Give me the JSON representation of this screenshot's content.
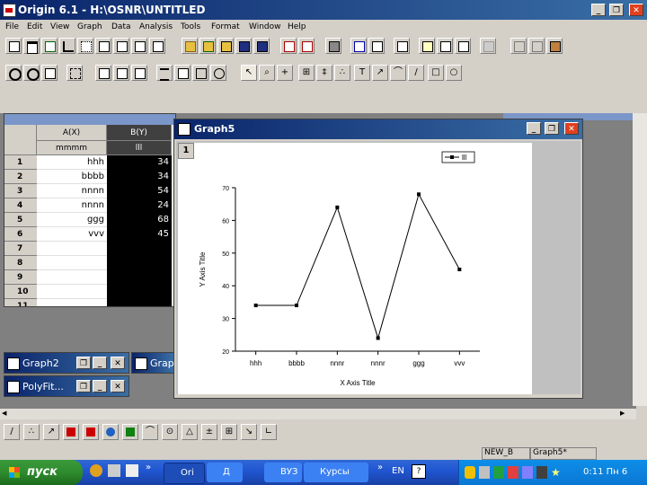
{
  "app": {
    "title": "Origin 6.1 - H:\\OSNR\\UNTITLED"
  },
  "window_controls": {
    "minimize": "_",
    "restore": "❐",
    "close": "✕"
  },
  "menu": [
    "File",
    "Edit",
    "View",
    "Graph",
    "Data",
    "Analysis",
    "Tools",
    "Format",
    "Window",
    "Help"
  ],
  "worksheet": {
    "col_a": "A(X)",
    "col_b": "B(Y)",
    "col_a_label": "mmmm",
    "col_b_label": "lll",
    "rows": [
      {
        "n": "1",
        "a": "hhh",
        "b": "34"
      },
      {
        "n": "2",
        "a": "bbbb",
        "b": "34"
      },
      {
        "n": "3",
        "a": "nnnn",
        "b": "54"
      },
      {
        "n": "4",
        "a": "nnnn",
        "b": "24"
      },
      {
        "n": "5",
        "a": "ggg",
        "b": "68"
      },
      {
        "n": "6",
        "a": "vvv",
        "b": "45"
      },
      {
        "n": "7",
        "a": "",
        "b": ""
      },
      {
        "n": "8",
        "a": "",
        "b": ""
      },
      {
        "n": "9",
        "a": "",
        "b": ""
      },
      {
        "n": "10",
        "a": "",
        "b": ""
      },
      {
        "n": "11",
        "a": "",
        "b": ""
      }
    ]
  },
  "graph_window": {
    "title": "Graph5",
    "layer": "1"
  },
  "chart_data": {
    "type": "line",
    "categories": [
      "hhh",
      "bbbb",
      "nnnr",
      "nnnr",
      "ggg",
      "vvv"
    ],
    "series": [
      {
        "name": "lll",
        "values": [
          34,
          34,
          64,
          24,
          68,
          45
        ],
        "color": "#000000"
      }
    ],
    "xlabel": "X Axis Title",
    "ylabel": "Y Axis Title",
    "ylim": [
      20,
      70
    ],
    "yticks": [
      20,
      30,
      40,
      50,
      60,
      70
    ],
    "legend": "top-right",
    "grid": false
  },
  "minimized": {
    "graph2": "Graph2",
    "graph_partial": "Grap",
    "polyfit": "PolyFit..."
  },
  "status": {
    "left": "NEW_B",
    "right": "Graph5*"
  },
  "taskbar": {
    "start": "пуск",
    "items": [
      "Ori",
      "Д",
      "ВУЗ",
      "Курсы"
    ],
    "lang": "EN",
    "time": "0:11 Пн 6"
  }
}
